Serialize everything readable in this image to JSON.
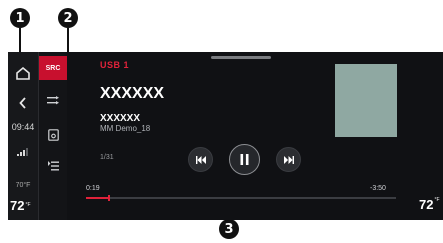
{
  "callouts": [
    "1",
    "2",
    "3"
  ],
  "system_bar": {
    "home_icon": "home-icon",
    "back_icon": "chevron-left-icon",
    "time": "09:44",
    "signal_icon": "signal-bars-icon",
    "outside_temp": "70°F",
    "driver_temp": "72",
    "driver_temp_unit": "°F"
  },
  "media_nav": {
    "src_label": "SRC",
    "icons": [
      "browse-icon",
      "album-art-icon",
      "list-icon"
    ]
  },
  "media": {
    "source": "USB 1",
    "track_title": "XXXXXX",
    "artist": "XXXXXX",
    "album": "MM Demo_18",
    "track_counter": "1/31",
    "elapsed": "0:19",
    "remaining": "-3:50",
    "progress_fraction": 0.07,
    "is_playing": true
  },
  "passenger_temp": "72",
  "passenger_temp_unit": "°F",
  "colors": {
    "accent": "#e0223a",
    "src_bg": "#c8102e",
    "screen_bg": "#101114",
    "cover": "#8fa8a2"
  }
}
